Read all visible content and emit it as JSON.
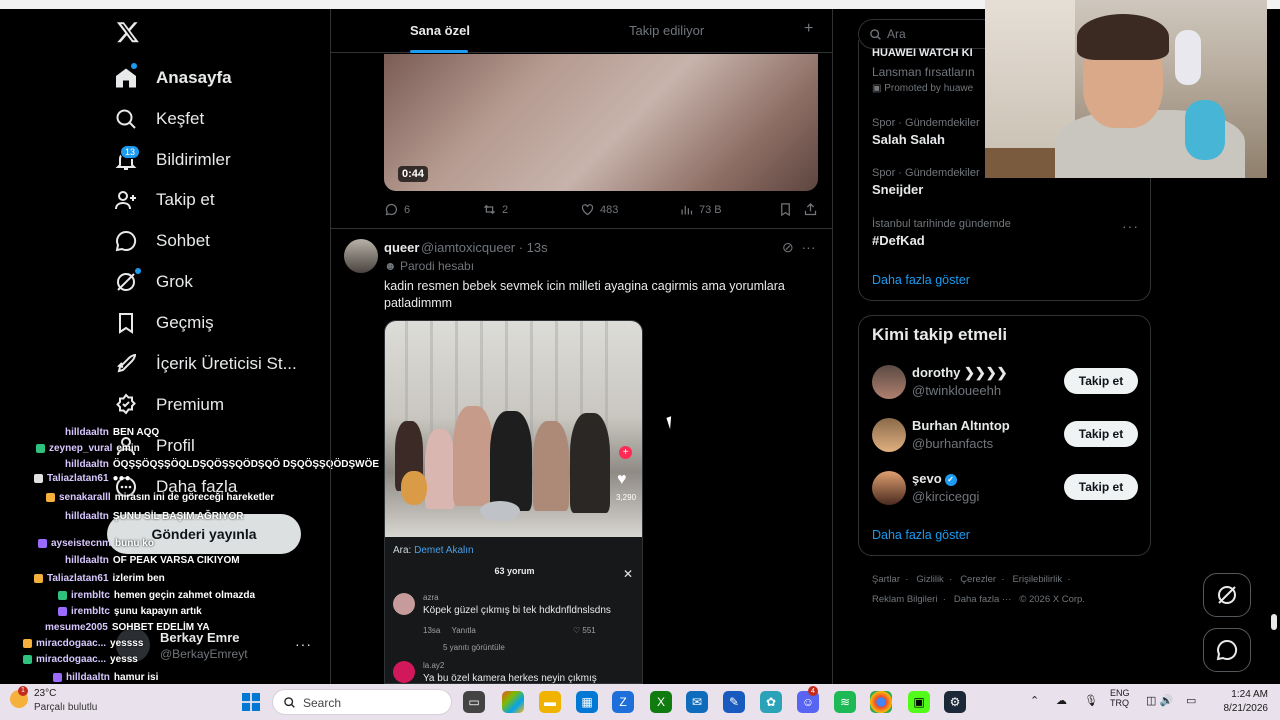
{
  "nav": {
    "items": [
      {
        "label": "Anasayfa",
        "icon": "home-icon"
      },
      {
        "label": "Keşfet",
        "icon": "search-icon"
      },
      {
        "label": "Bildirimler",
        "icon": "bell-icon",
        "badge": "13"
      },
      {
        "label": "Takip et",
        "icon": "person-add-icon"
      },
      {
        "label": "Sohbet",
        "icon": "chat-icon"
      },
      {
        "label": "Grok",
        "icon": "grok-icon"
      },
      {
        "label": "Geçmiş",
        "icon": "bookmark-icon"
      },
      {
        "label": "İçerik Üreticisi St...",
        "icon": "rocket-icon"
      },
      {
        "label": "Premium",
        "icon": "premium-icon"
      },
      {
        "label": "Profil",
        "icon": "profile-icon"
      },
      {
        "label": "Daha fazla",
        "icon": "more-circle-icon"
      }
    ],
    "post_button": "Gönderi yayınla",
    "account": {
      "name": "Berkay Emre",
      "handle": "@BerkayEmreyt"
    }
  },
  "chat": [
    {
      "user": "hilldaaltn",
      "text": "BEN AQQ"
    },
    {
      "user": "zeynep_vural",
      "text": "emin"
    },
    {
      "user": "hilldaaltn",
      "text": "ÖQŞŞÖQŞŞÖQLDŞQÖŞŞQÖDŞQÖ DŞQÖŞŞQÖDŞWÖE"
    },
    {
      "user": "Taliazlatan61",
      "text": "●●●"
    },
    {
      "user": "senakaralll",
      "text": "mirasın ini de göreceği hareketler"
    },
    {
      "user": "hilldaaltn",
      "text": "ŞUNU SİL BAŞIM AĞRIYOR"
    },
    {
      "user": "ayseistecnm",
      "text": "bunu ko"
    },
    {
      "user": "hilldaaltn",
      "text": "OF PEAK VARSA CIKIYOM"
    },
    {
      "user": "Taliazlatan61",
      "text": "izlerim ben"
    },
    {
      "user": "irembltc",
      "text": "hemen geçin zahmet olmazda"
    },
    {
      "user": "irembltc",
      "text": "şunu kapayın artık"
    },
    {
      "user": "mesume2005",
      "text": "SOHBET EDELİM YA"
    },
    {
      "user": "miracdogaac...",
      "text": "yessss"
    },
    {
      "user": "miracdogaac...",
      "text": "yesss"
    },
    {
      "user": "hilldaaltn",
      "text": "hamur isi"
    }
  ],
  "tabs": {
    "for_you": "Sana özel",
    "following": "Takip ediliyor",
    "add": "+"
  },
  "video": {
    "duration": "0:44"
  },
  "video_actions": {
    "replies": "6",
    "reposts": "2",
    "likes": "483",
    "views": "73 B"
  },
  "tweet": {
    "name": "queer",
    "handle": "@iamtoxicqueer · 13s",
    "parody": "Parodi hesabı",
    "text": "kadin resmen bebek sevmek icin milleti ayagina cagirmis ama yorumlara patladimmm",
    "media": {
      "like_count": "3,290",
      "search_prefix": "Ara:",
      "search_term": "Demet Akalın",
      "comments_header": "63 yorum",
      "comment1": {
        "user": "azra",
        "text": "Köpek güzel çıkmış bi tek hdkdnfldnslsdns",
        "time": "13sa",
        "reply": "Yanıtla",
        "likes": "551",
        "view_replies": "5 yanıtı görüntüle"
      },
      "comment2": {
        "user": "la.ay2",
        "text": "Ya bu özel kamera herkes neyin çıkmış"
      }
    }
  },
  "right": {
    "search_placeholder": "Ara",
    "promo": {
      "title": "HUAWEI WATCH KI",
      "subtitle": "Lansman fırsatların",
      "promoted": "Promoted by huawe"
    },
    "trends": [
      {
        "category": "Spor · Gündemdekiler",
        "topic": "Salah Salah"
      },
      {
        "category": "Spor · Gündemdekiler",
        "topic": "Sneijder"
      },
      {
        "category": "İstanbul tarihinde gündemde",
        "topic": "#DefKad"
      }
    ],
    "show_more": "Daha fazla göster",
    "who_title": "Kimi takip etmeli",
    "who": [
      {
        "name": "dorothy ❯❯❯❯",
        "handle": "@twinkloueehh",
        "button": "Takip et"
      },
      {
        "name": "Burhan Altıntop",
        "handle": "@burhanfacts",
        "button": "Takip et"
      },
      {
        "name": "şevo",
        "handle": "@kirciceggi",
        "button": "Takip et",
        "verified": true
      }
    ],
    "who_show_more": "Daha fazla göster",
    "footer": {
      "line1": [
        "Şartlar",
        "Gizlilik",
        "Çerezler",
        "Erişilebilirlik"
      ],
      "line2": [
        "Reklam Bilgileri",
        "Daha fazla ···",
        "© 2026 X Corp."
      ]
    }
  },
  "taskbar": {
    "temp": "23°C",
    "weather": "Parçalı bulutlu",
    "alert": "1",
    "search": "Search",
    "lang1": "ENG",
    "lang2": "TRQ",
    "time": "1:24 AM",
    "date": "8/21/2026",
    "messenger_badge": "4"
  },
  "colors": {
    "accent": "#1d9bf0",
    "bg": "#000000",
    "text": "#e7e9ea",
    "muted": "#71767b",
    "border": "#2f3336"
  }
}
